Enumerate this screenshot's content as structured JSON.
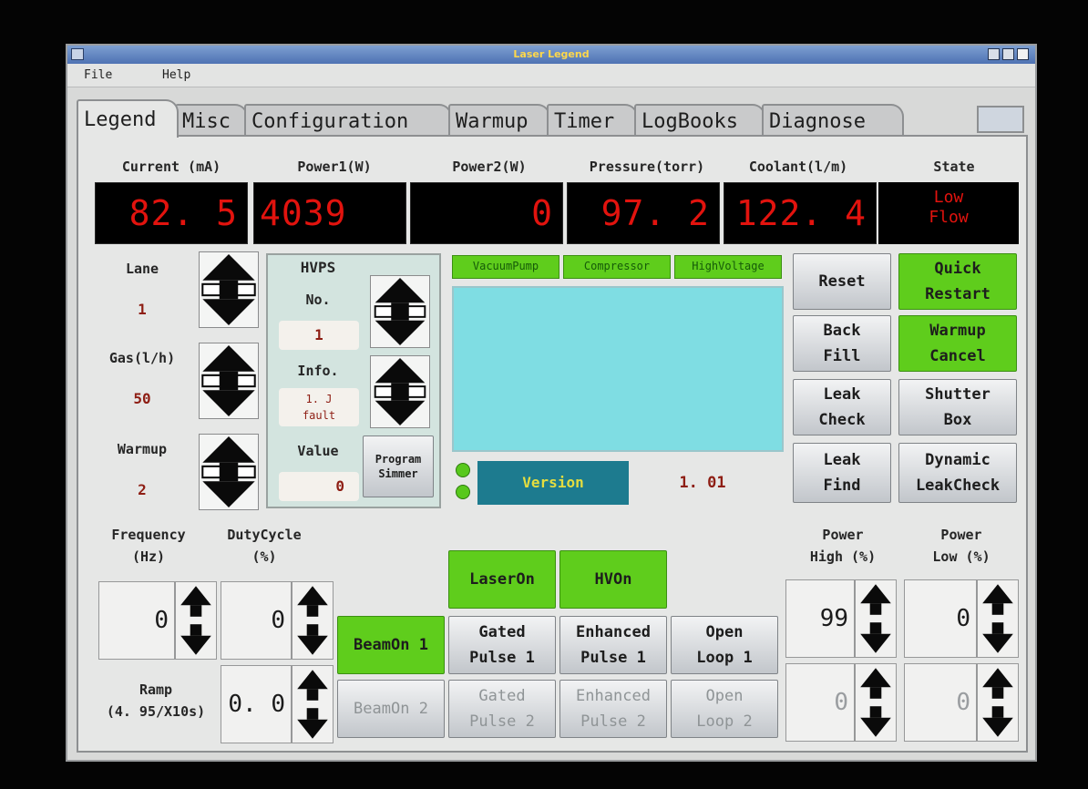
{
  "window": {
    "title": "Laser Legend"
  },
  "menu": {
    "file": "File",
    "help": "Help"
  },
  "tabs": [
    "Legend",
    "Misc",
    "Configuration",
    "Warmup",
    "Timer",
    "LogBooks",
    "Diagnose"
  ],
  "readouts": {
    "current": {
      "label": "Current (mA)",
      "value": "82. 5"
    },
    "power1": {
      "label": "Power1(W)",
      "value": "4039"
    },
    "power2": {
      "label": "Power2(W)",
      "value": "0"
    },
    "pressure": {
      "label": "Pressure(torr)",
      "value": "97. 2"
    },
    "coolant": {
      "label": "Coolant(l/m)",
      "value": "122. 4"
    },
    "state": {
      "label": "State",
      "value_line1": "Low",
      "value_line2": "Flow"
    }
  },
  "left": {
    "lane": {
      "label": "Lane",
      "value": "1"
    },
    "gas": {
      "label": "Gas(l/h)",
      "value": "50"
    },
    "warmup": {
      "label": "Warmup",
      "value": "2"
    }
  },
  "hvps": {
    "title": "HVPS",
    "no_label": "No.",
    "no_value": "1",
    "info_label": "Info.",
    "info_line1": "1. J",
    "info_line2": "fault",
    "value_label": "Value",
    "value": "0",
    "program_line1": "Program",
    "program_line2": "Simmer"
  },
  "status_indicators": [
    "VacuumPump",
    "Compressor",
    "HighVoltage"
  ],
  "version": {
    "label": "Version",
    "value": "1. 01"
  },
  "control_buttons": {
    "reset": "Reset",
    "quick_restart": [
      "Quick",
      "Restart"
    ],
    "back_fill": [
      "Back",
      "Fill"
    ],
    "warmup_cancel": [
      "Warmup",
      "Cancel"
    ],
    "leak_check": [
      "Leak",
      "Check"
    ],
    "shutter_box": [
      "Shutter",
      "Box"
    ],
    "leak_find": [
      "Leak",
      "Find"
    ],
    "dynamic_leakcheck": [
      "Dynamic",
      "LeakCheck"
    ]
  },
  "bottom": {
    "frequency": {
      "label1": "Frequency",
      "label2": "(Hz)",
      "value": "0"
    },
    "duty_cycle": {
      "label1": "DutyCycle",
      "label2": "(%)",
      "value": "0"
    },
    "ramp": {
      "label1": "Ramp",
      "label2": "(4. 95/X10s)",
      "value": "0. 0"
    },
    "power_high": {
      "label1": "Power",
      "label2": "High (%)",
      "value": "99",
      "value2": "0"
    },
    "power_low": {
      "label1": "Power",
      "label2": "Low (%)",
      "value": "0",
      "value2": "0"
    }
  },
  "beam_buttons": {
    "laser_on": "LaserOn",
    "hv_on": "HVOn",
    "beam_on_1": "BeamOn 1",
    "gated_pulse_1": [
      "Gated",
      "Pulse 1"
    ],
    "enhanced_pulse_1": [
      "Enhanced",
      "Pulse 1"
    ],
    "open_loop_1": [
      "Open",
      "Loop 1"
    ],
    "beam_on_2": "BeamOn 2",
    "gated_pulse_2": [
      "Gated",
      "Pulse 2"
    ],
    "enhanced_pulse_2": [
      "Enhanced",
      "Pulse 2"
    ],
    "open_loop_2": [
      "Open",
      "Loop 2"
    ]
  },
  "colors": {
    "led_red": "#e2130e",
    "green_active": "#5fcd1c",
    "screen": "#7fdde3",
    "version_bg": "#1d7b8f"
  }
}
